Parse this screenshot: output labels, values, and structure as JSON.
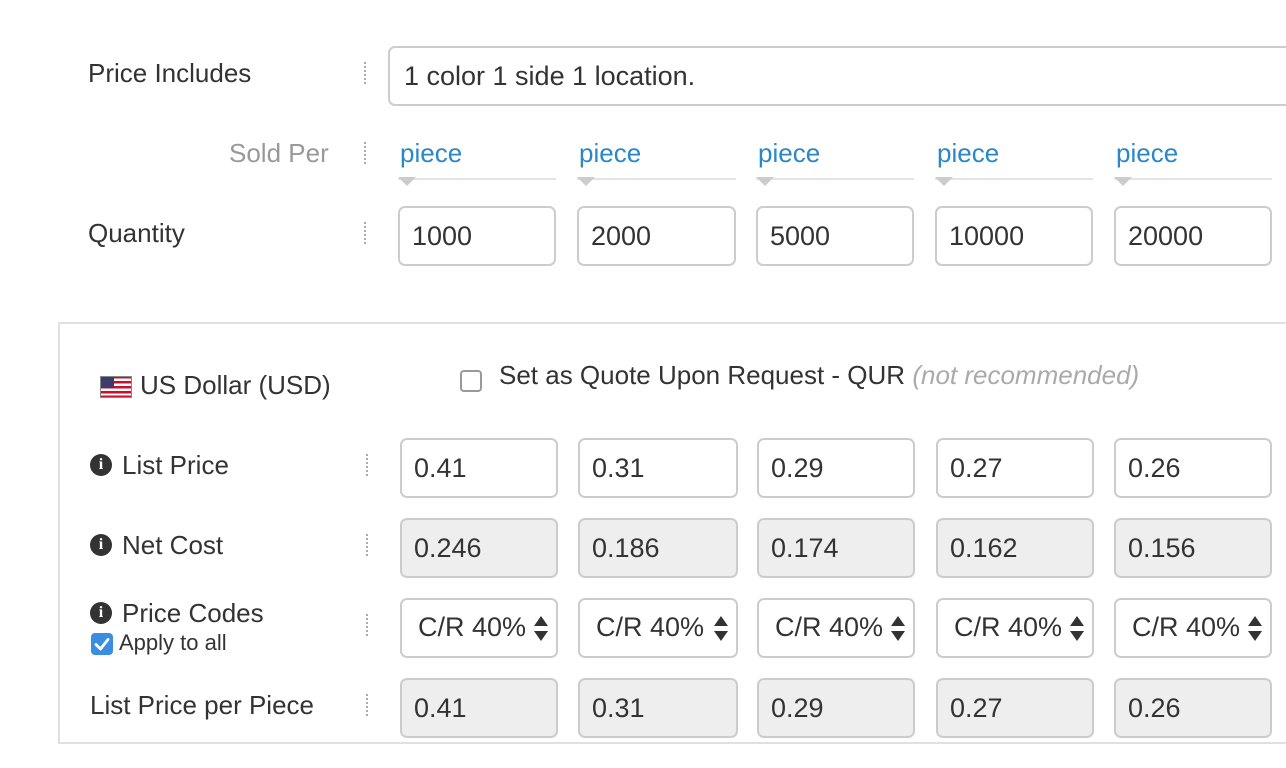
{
  "price_includes": {
    "label": "Price Includes",
    "value": "1 color 1 side 1 location."
  },
  "sold_per": {
    "label": "Sold Per",
    "units": [
      "piece",
      "piece",
      "piece",
      "piece",
      "piece"
    ]
  },
  "quantity": {
    "label": "Quantity",
    "values": [
      "1000",
      "2000",
      "5000",
      "10000",
      "20000"
    ]
  },
  "currency": {
    "label": "US Dollar (USD)",
    "flag_icon": "us-flag-icon"
  },
  "qur": {
    "label": "Set as Quote Upon Request - QUR",
    "note": "(not recommended)",
    "checked": false
  },
  "list_price": {
    "label": "List Price",
    "values": [
      "0.41",
      "0.31",
      "0.29",
      "0.27",
      "0.26"
    ]
  },
  "net_cost": {
    "label": "Net Cost",
    "values": [
      "0.246",
      "0.186",
      "0.174",
      "0.162",
      "0.156"
    ]
  },
  "price_codes": {
    "label": "Price Codes",
    "apply_all_label": "Apply to all",
    "apply_all_checked": true,
    "values": [
      "C/R 40%",
      "C/R 40%",
      "C/R 40%",
      "C/R 40%",
      "C/R 40%"
    ]
  },
  "list_price_per_piece": {
    "label": "List Price per Piece",
    "values": [
      "0.41",
      "0.31",
      "0.29",
      "0.27",
      "0.26"
    ]
  },
  "colors": {
    "link": "#2a87c8",
    "readonly_bg": "#eeeeee",
    "checkbox_checked": "#3b8de0"
  }
}
